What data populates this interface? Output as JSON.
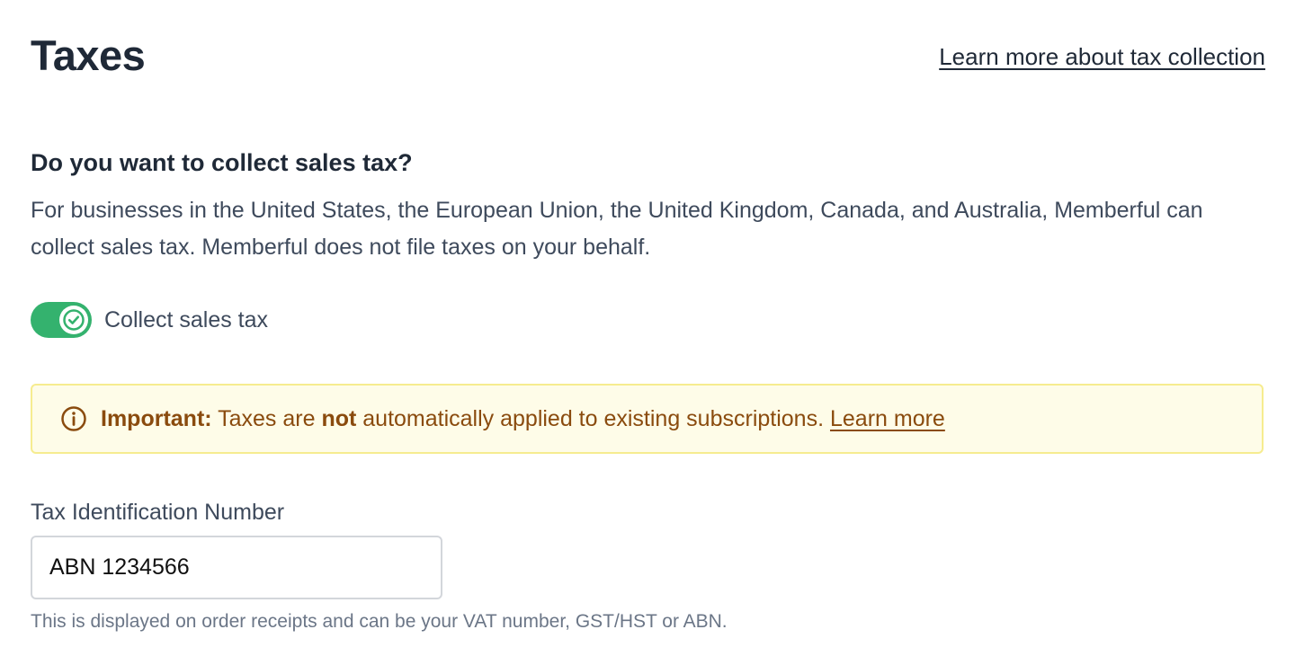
{
  "header": {
    "title": "Taxes",
    "learn_more_link": "Learn more about tax collection"
  },
  "section": {
    "heading": "Do you want to collect sales tax?",
    "description": "For businesses in the United States, the European Union, the United Kingdom, Canada, and Australia, Memberful can collect sales tax. Memberful does not file taxes on your behalf."
  },
  "toggle": {
    "label": "Collect sales tax",
    "checked": true,
    "color": "#34b26e",
    "icon": "check-icon"
  },
  "notice": {
    "icon": "info-circle-icon",
    "strong_prefix": "Important:",
    "text_before": " Taxes are ",
    "emphasis": "not",
    "text_after": " automatically applied to existing subscriptions. ",
    "link": "Learn more",
    "background": "#fefce8",
    "border": "#f6ec8f",
    "text_color": "#8a4b0e"
  },
  "tax_field": {
    "label": "Tax Identification Number",
    "value": "ABN 1234566",
    "hint": "This is displayed on order receipts and can be your VAT number, GST/HST or ABN."
  }
}
